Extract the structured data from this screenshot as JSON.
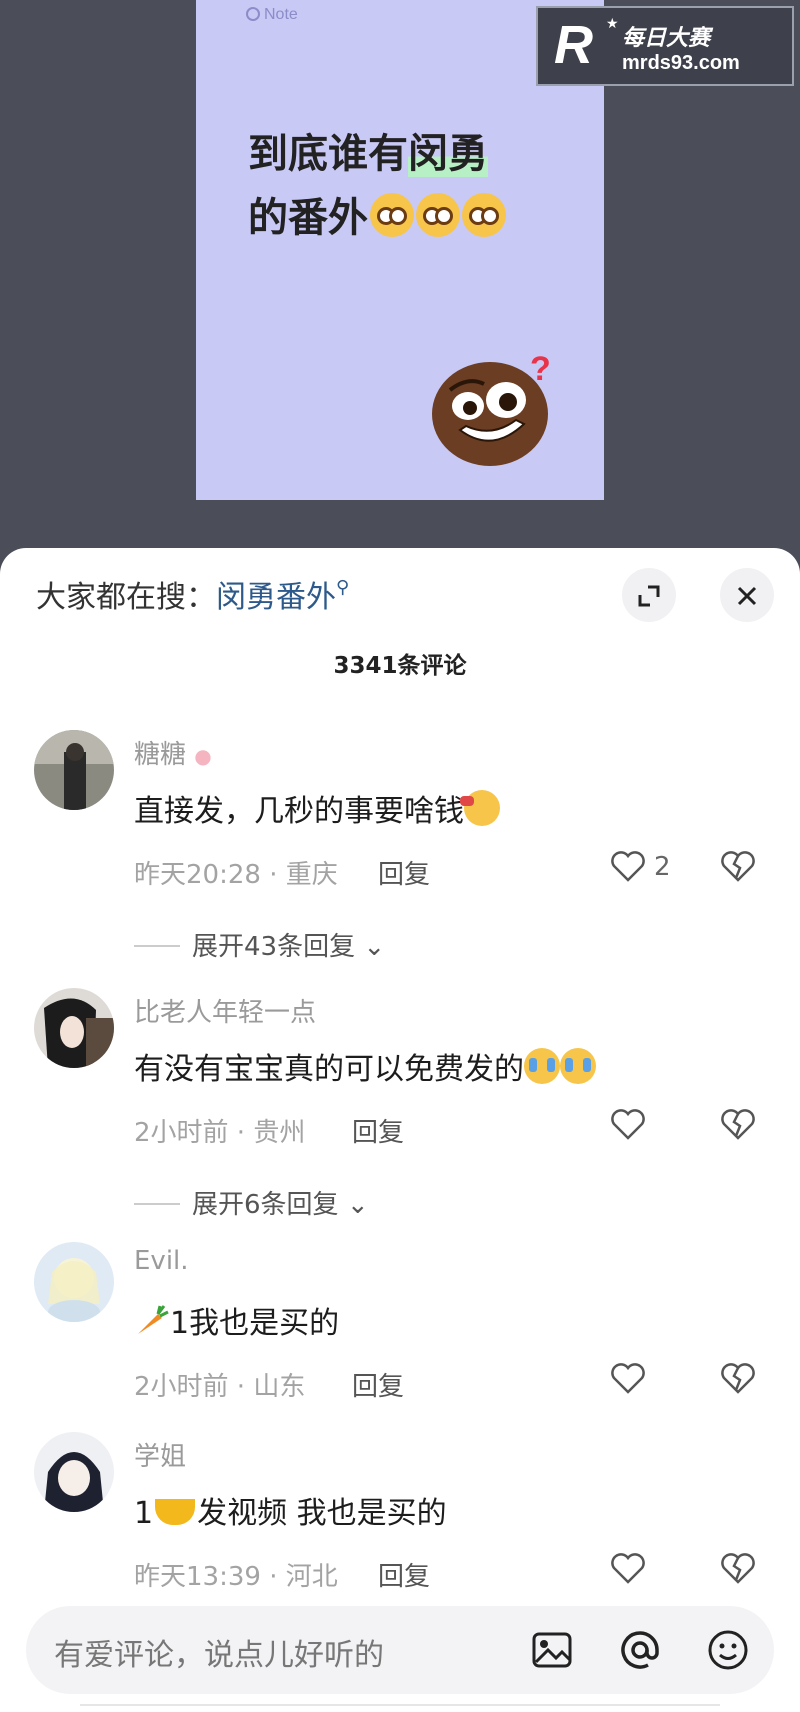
{
  "note_card": {
    "tag": "Note",
    "title_line1_plain": "到底谁有",
    "title_line1_highlight": "闵勇",
    "title_line2": "的番外"
  },
  "watermark": {
    "logo_letter": "R",
    "name": "每日大赛",
    "url": "mrds93.com"
  },
  "sheet": {
    "search_prefix": "大家都在搜：",
    "search_keyword": "闵勇番外",
    "comment_count": "3341条评论",
    "expand_icon": "expand-icon",
    "close_icon": "close-icon"
  },
  "comments": [
    {
      "name": "糖糖",
      "text": "直接发，几秒的事要啥钱",
      "time_location": "昨天20:28 · 重庆",
      "reply_label": "回复",
      "likes": "2",
      "expand_label": "展开43条回复"
    },
    {
      "name": "比老人年轻一点",
      "text": "有没有宝宝真的可以免费发的",
      "time_location": "2小时前 · 贵州",
      "reply_label": "回复",
      "likes": "",
      "expand_label": "展开6条回复"
    },
    {
      "name": "Evil.",
      "text": "1我也是买的",
      "time_location": "2小时前 · 山东",
      "reply_label": "回复",
      "likes": ""
    },
    {
      "name": "学姐",
      "text_prefix": "1",
      "text": "发视频 我也是买的",
      "time_location": "昨天13:39 · 河北",
      "reply_label": "回复",
      "likes": ""
    }
  ],
  "input": {
    "placeholder": "有爱评论，说点儿好听的",
    "icons": [
      "image-icon",
      "at-icon",
      "emoji-icon"
    ]
  }
}
